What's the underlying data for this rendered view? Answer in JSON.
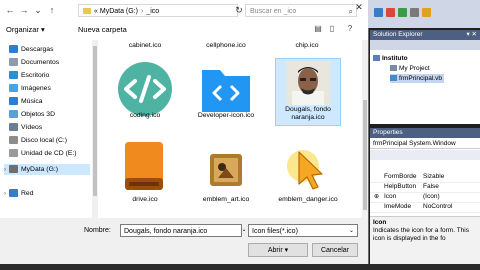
{
  "toolbar": {
    "address_drive": "MyData (G:)",
    "address_folder": "_ico",
    "search_placeholder": "Buscar en _ico"
  },
  "commands": {
    "organize": "Organizar",
    "new_folder": "Nueva carpeta"
  },
  "nav": {
    "items": [
      {
        "label": "Descargas",
        "icon": "download-icon",
        "color": "#2a7fd4"
      },
      {
        "label": "Documentos",
        "icon": "documents-icon",
        "color": "#8c9cad"
      },
      {
        "label": "Escritorio",
        "icon": "desktop-icon",
        "color": "#2a8fd6"
      },
      {
        "label": "Imágenes",
        "icon": "pictures-icon",
        "color": "#4aa3e0"
      },
      {
        "label": "Música",
        "icon": "music-icon",
        "color": "#2a7fd4"
      },
      {
        "label": "Objetos 3D",
        "icon": "cube-icon",
        "color": "#5aa0d8"
      },
      {
        "label": "Vídeos",
        "icon": "video-icon",
        "color": "#6a7e94"
      },
      {
        "label": "Disco local (C:)",
        "icon": "drive-icon",
        "color": "#8c8c8c"
      },
      {
        "label": "Unidad de CD (E:)",
        "icon": "cd-drive-icon",
        "color": "#9a9a9a"
      },
      {
        "label": "MyData (G:)",
        "icon": "drive-icon",
        "color": "#6e6e6e"
      },
      {
        "label": "Red",
        "icon": "network-icon",
        "color": "#3a7bc8"
      }
    ]
  },
  "files": {
    "top_row": [
      "cabinet.ico",
      "cellphone.ico",
      "chip.ico"
    ],
    "items": [
      {
        "name": "coding.ico",
        "icon": "code-icon"
      },
      {
        "name": "Developer-icon.ico",
        "icon": "developer-icon"
      },
      {
        "name": "Dougals, fondo naranja.ico",
        "icon": "portrait-photo"
      },
      {
        "name": "drive.ico",
        "icon": "orange-drive-icon"
      },
      {
        "name": "emblem_art.ico",
        "icon": "art-icon"
      },
      {
        "name": "emblem_danger.ico",
        "icon": "cursor-danger-icon"
      }
    ]
  },
  "footer": {
    "filename_label": "Nombre:",
    "filename_value": "Dougals, fondo naranja.ico",
    "filetype_value": "Icon files(*.ico)",
    "open_label": "Abrir",
    "cancel_label": "Cancelar"
  },
  "solution_explorer": {
    "title": "Solution Explorer",
    "pin": "▾ ✕",
    "items": [
      "Instituto",
      "My Project",
      "frmPrincipal.vb"
    ]
  },
  "properties": {
    "title": "Properties",
    "object": "frmPrincipal System.Window",
    "rows": [
      {
        "key": "FormBorde",
        "value": "Sizable"
      },
      {
        "key": "HelpButton",
        "value": "False"
      },
      {
        "key": "Icon",
        "value": "(Icon)"
      },
      {
        "key": "ImeMode",
        "value": "NoControl"
      }
    ],
    "desc_title": "Icon",
    "desc_text": "Indicates the icon for a form. This icon is displayed in the fo"
  }
}
